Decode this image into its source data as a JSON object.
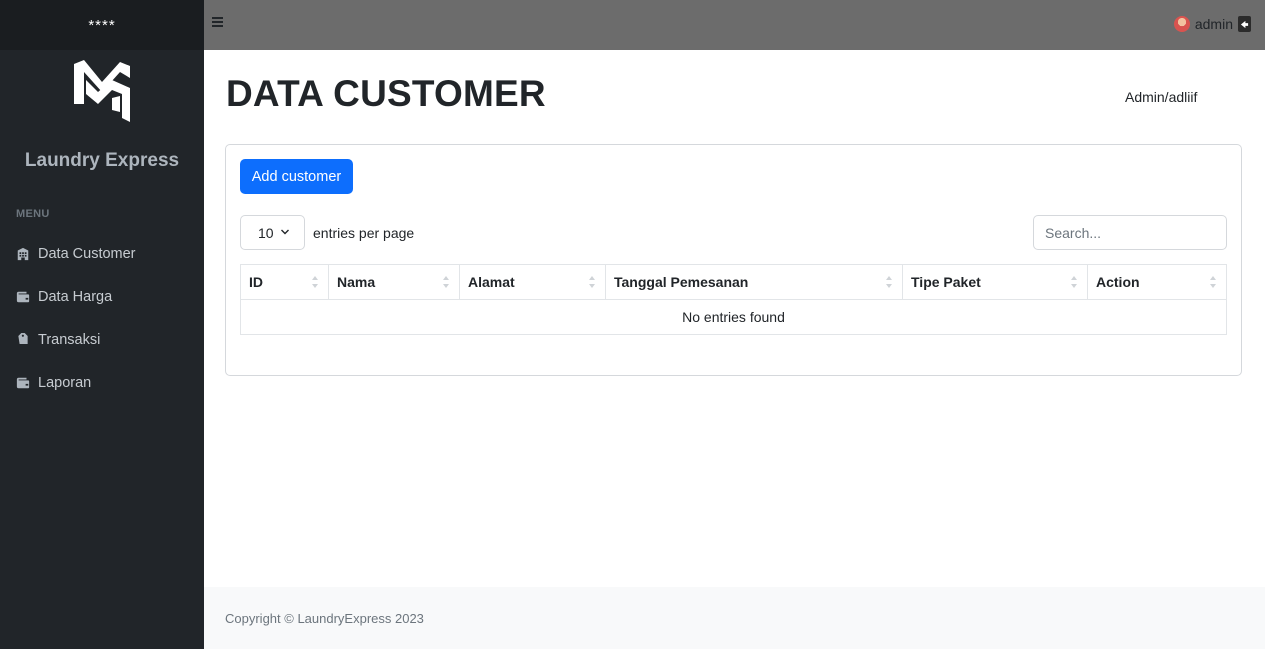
{
  "sidebar": {
    "brand": "****",
    "app_name": "Laundry Express",
    "menu_heading": "MENU",
    "items": [
      {
        "label": "Data Customer",
        "icon": "building-icon"
      },
      {
        "label": "Data Harga",
        "icon": "wallet-icon"
      },
      {
        "label": "Transaksi",
        "icon": "tag-icon"
      },
      {
        "label": "Laporan",
        "icon": "wallet-icon"
      }
    ]
  },
  "topbar": {
    "user_name": "admin"
  },
  "main": {
    "title": "DATA CUSTOMER",
    "breadcrumb": "Admin/adliif",
    "add_button": "Add customer",
    "per_page_value": "10",
    "per_page_label": "entries per page",
    "search_placeholder": "Search...",
    "columns": [
      "ID",
      "Nama",
      "Alamat",
      "Tanggal Pemesanan",
      "Tipe Paket",
      "Action"
    ],
    "empty_message": "No entries found"
  },
  "footer": {
    "copyright": "Copyright © LaundryExpress 2023"
  },
  "colors": {
    "primary": "#0d6efd",
    "sidebar_bg": "#212529",
    "topbar_bg": "#6c6c6c"
  }
}
